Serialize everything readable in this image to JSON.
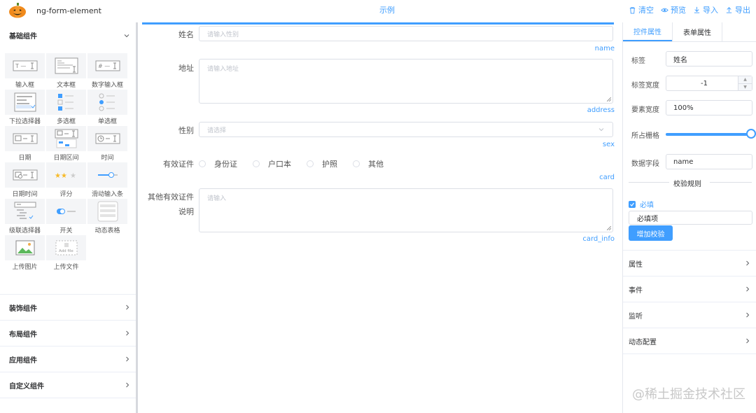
{
  "header": {
    "app_title": "ng-form-element",
    "center_title": "示例",
    "tools": [
      "清空",
      "预览",
      "导入",
      "导出"
    ]
  },
  "left": {
    "basic_group": "基础组件",
    "components": [
      "输入框",
      "文本框",
      "数字输入框",
      "下拉选择器",
      "多选框",
      "单选框",
      "日期",
      "日期区间",
      "时间",
      "日期时间",
      "评分",
      "滑动输入条",
      "级联选择器",
      "开关",
      "动态表格",
      "上传图片",
      "上传文件"
    ],
    "add_file_text": "Add file",
    "groups": [
      "装饰组件",
      "布局组件",
      "应用组件",
      "自定义组件"
    ]
  },
  "main": {
    "fields": {
      "name": {
        "label": "姓名",
        "placeholder": "请输入性别",
        "tag": "name"
      },
      "address": {
        "label": "地址",
        "placeholder": "请输入地址",
        "tag": "address"
      },
      "sex": {
        "label": "性别",
        "placeholder": "请选择",
        "tag": "sex"
      },
      "card": {
        "label": "有效证件",
        "options": [
          "身份证",
          "户口本",
          "护照",
          "其他"
        ],
        "tag": "card"
      },
      "card_info": {
        "label": "其他有效证件",
        "label2": "说明",
        "placeholder": "请输入",
        "tag": "card_info"
      }
    }
  },
  "right": {
    "tabs": [
      "控件属性",
      "表单属性"
    ],
    "props": {
      "label_label": "标签",
      "label_value": "姓名",
      "width_label": "标签宽度",
      "width_value": "-1",
      "element_width_label": "要素宽度",
      "element_width_value": "100%",
      "grid_label": "所占栅格",
      "field_label": "数据字段",
      "field_value": "name"
    },
    "validation_title": "校验规则",
    "required_label": "必填",
    "required_message": "必填项",
    "add_rule_button": "增加校验",
    "sections": [
      "属性",
      "事件",
      "监听",
      "动态配置"
    ]
  },
  "watermark": "@稀土掘金技术社区"
}
